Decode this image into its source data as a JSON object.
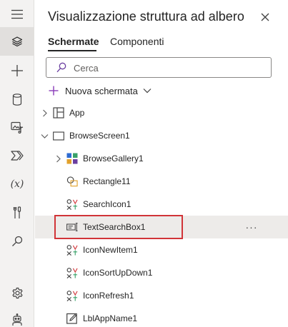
{
  "panel": {
    "title": "Visualizzazione struttura ad albero",
    "close_icon": "close-icon"
  },
  "tabs": [
    {
      "label": "Schermate",
      "active": true
    },
    {
      "label": "Componenti",
      "active": false
    }
  ],
  "search": {
    "placeholder": "Cerca",
    "value": ""
  },
  "new_screen": {
    "label": "Nuova schermata",
    "icon": "plus-icon",
    "caret": "chevron-down-icon"
  },
  "rail": {
    "items": [
      {
        "icon": "hamburger-menu-icon",
        "active": false
      },
      {
        "icon": "layers-icon",
        "active": true
      },
      {
        "icon": "plus-icon",
        "active": false
      },
      {
        "icon": "database-icon",
        "active": false
      },
      {
        "icon": "media-icon",
        "active": false
      },
      {
        "icon": "power-automate-icon",
        "active": false
      },
      {
        "icon": "variables-icon",
        "label": "(x)",
        "active": false
      },
      {
        "icon": "tools-icon",
        "active": false
      },
      {
        "icon": "search-icon",
        "active": false
      },
      {
        "icon": "settings-icon",
        "active": false
      },
      {
        "icon": "virtual-agent-icon",
        "active": false
      }
    ]
  },
  "tree": {
    "items": [
      {
        "label": "App",
        "icon": "app-icon",
        "chevron": "right"
      },
      {
        "label": "BrowseScreen1",
        "icon": "screen-icon",
        "chevron": "down"
      },
      {
        "label": "BrowseGallery1",
        "icon": "gallery-icon",
        "chevron": "right"
      },
      {
        "label": "Rectangle11",
        "icon": "shapes-icon"
      },
      {
        "label": "SearchIcon1",
        "icon": "icon-control-icon"
      },
      {
        "label": "TextSearchBox1",
        "icon": "text-input-icon",
        "selected": true,
        "more_label": "···"
      },
      {
        "label": "IconNewItem1",
        "icon": "icon-control-icon"
      },
      {
        "label": "IconSortUpDown1",
        "icon": "icon-control-icon"
      },
      {
        "label": "IconRefresh1",
        "icon": "icon-control-icon"
      },
      {
        "label": "LblAppName1",
        "icon": "label-edit-icon"
      }
    ]
  },
  "colors": {
    "highlight_border": "#d13438",
    "selected_row": "#edebe9",
    "rail_bg": "#f3f2f1"
  }
}
